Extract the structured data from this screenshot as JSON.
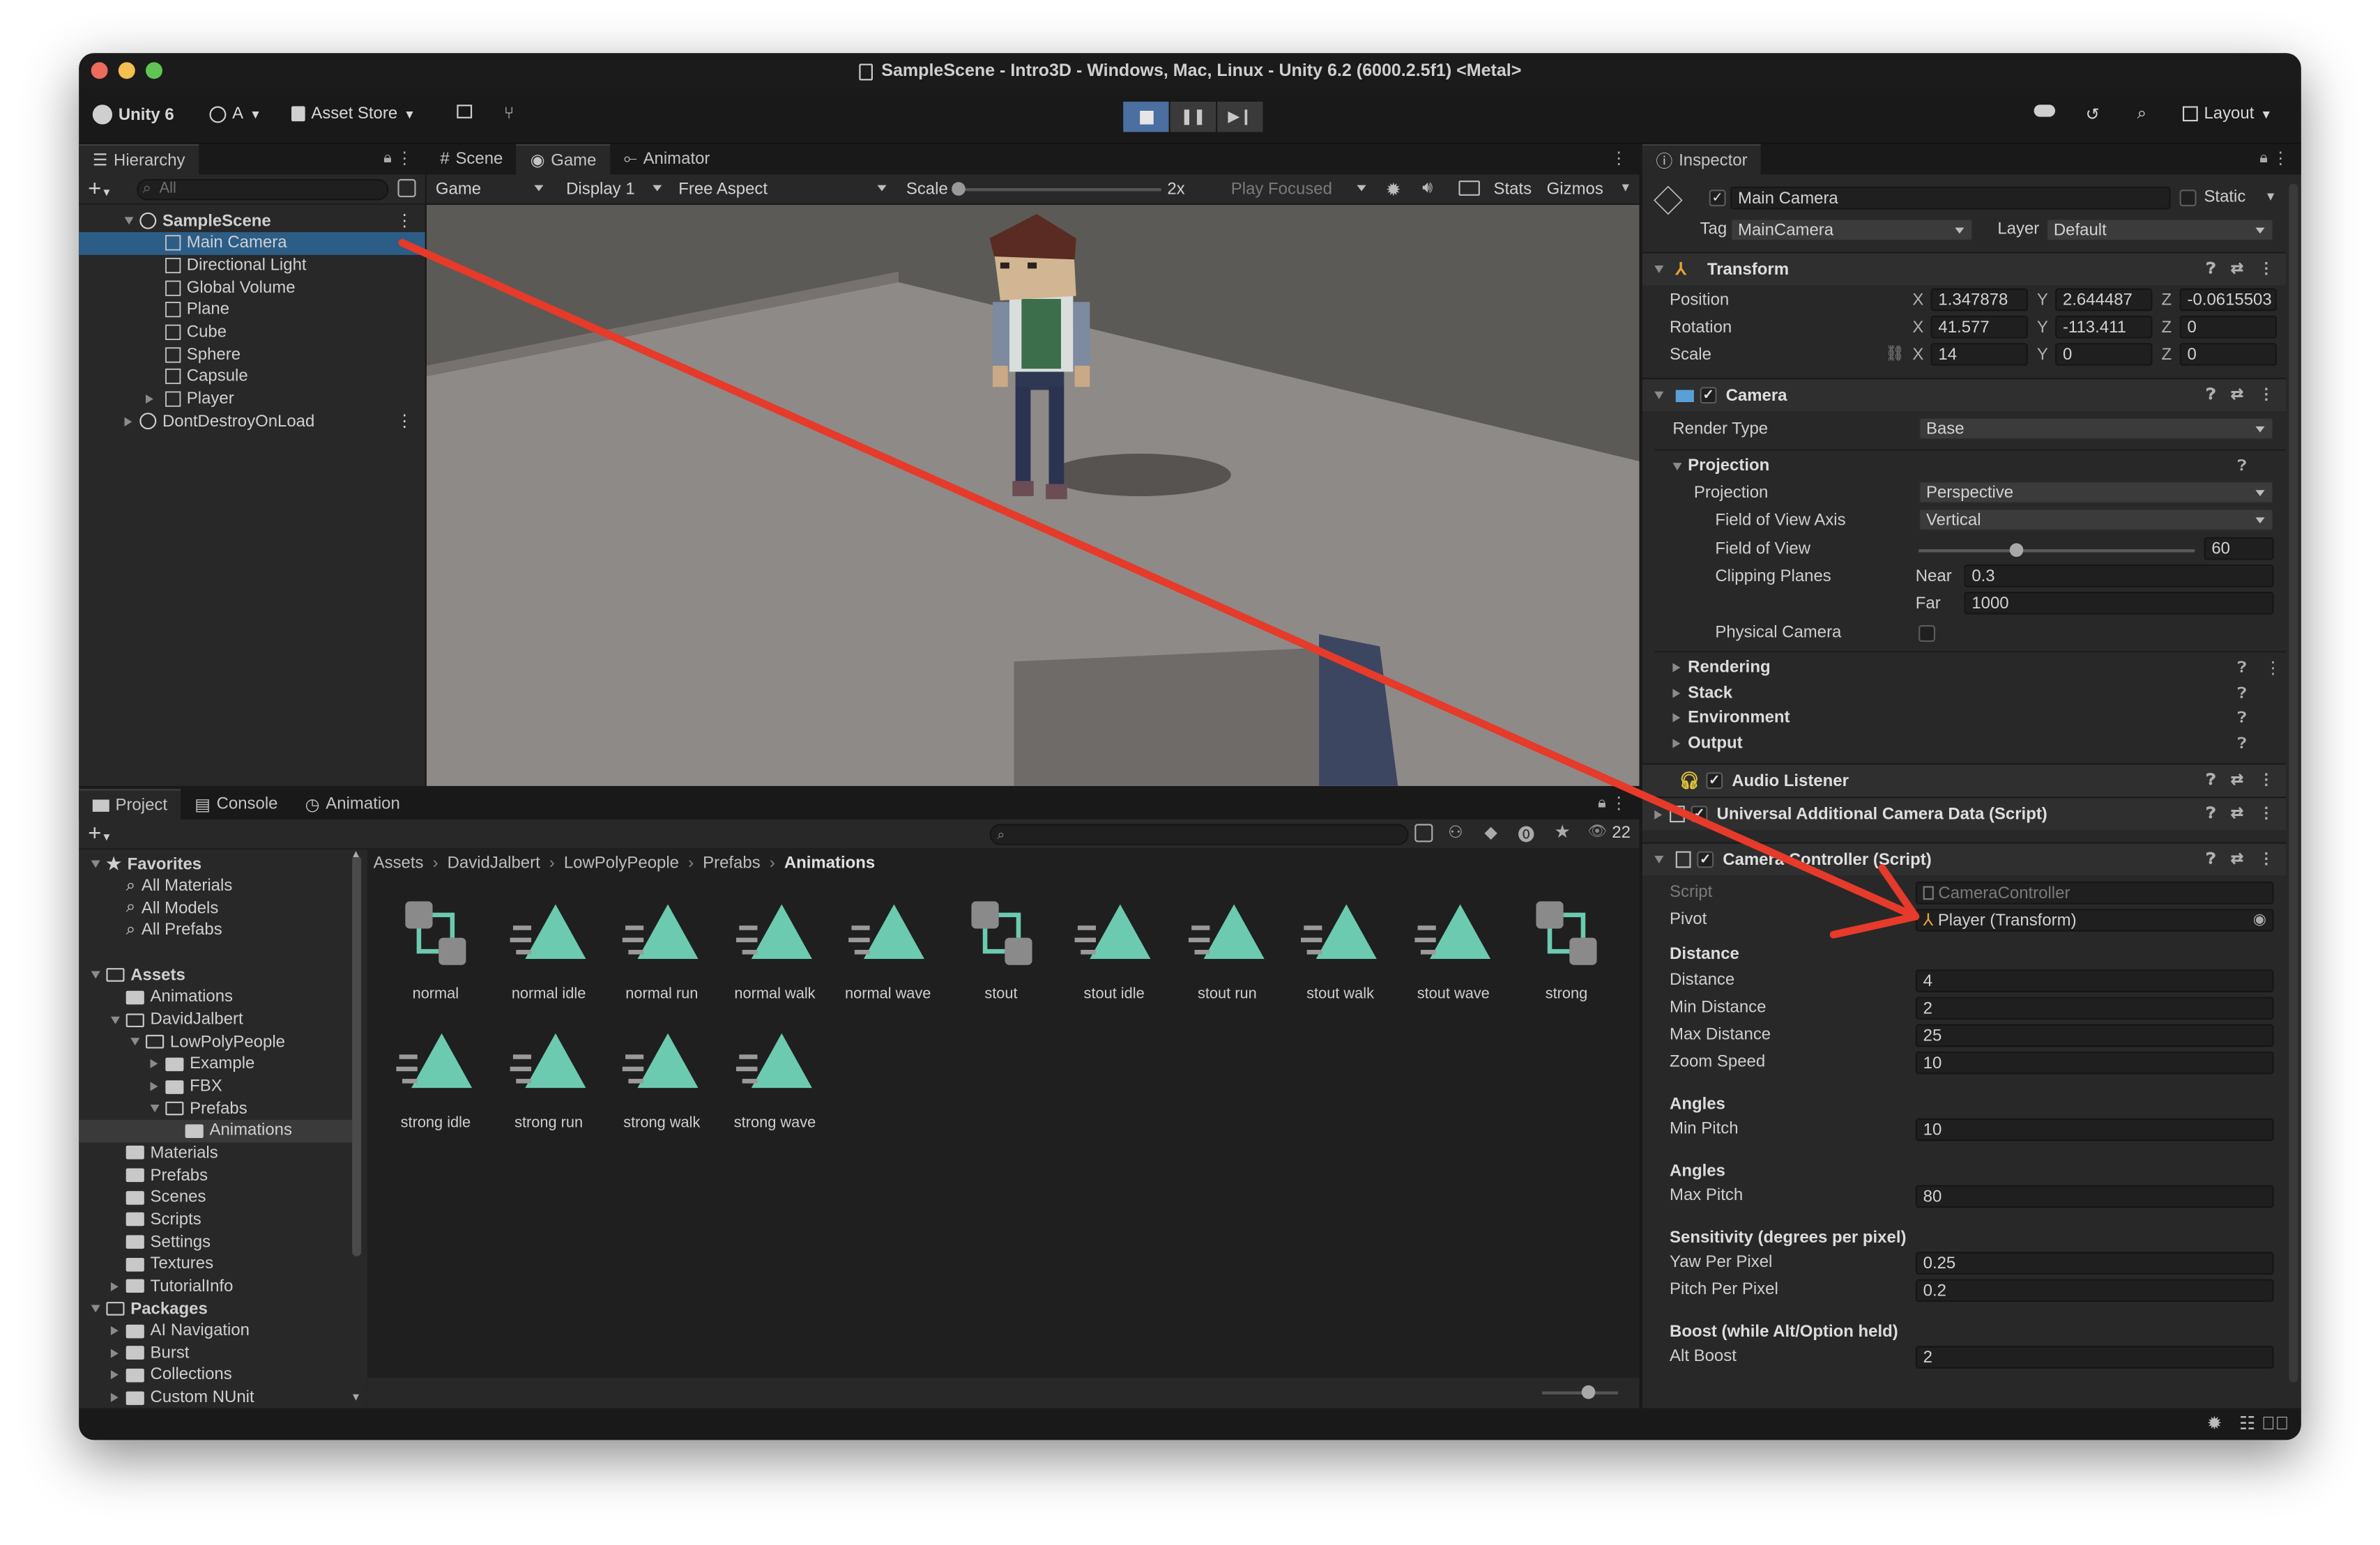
{
  "window": {
    "title": "SampleScene - Intro3D - Windows, Mac, Linux - Unity 6.2 (6000.2.5f1) <Metal>"
  },
  "toolbar": {
    "unity": "Unity 6",
    "account": "A",
    "asset_store": "Asset Store",
    "layout": "Layout"
  },
  "hierarchy": {
    "tab": "Hierarchy",
    "search_placeholder": "All",
    "scene": "SampleScene",
    "items": [
      "Main Camera",
      "Directional Light",
      "Global Volume",
      "Plane",
      "Cube",
      "Sphere",
      "Capsule",
      "Player"
    ],
    "dont_destroy": "DontDestroyOnLoad"
  },
  "view_tabs": [
    "Scene",
    "Game",
    "Animator"
  ],
  "game_bar": {
    "mode": "Game",
    "display": "Display 1",
    "aspect": "Free Aspect",
    "scale_label": "Scale",
    "scale_value": "2x",
    "play_focused": "Play Focused",
    "stats": "Stats",
    "gizmos": "Gizmos"
  },
  "bottom_tabs": [
    "Project",
    "Console",
    "Animation"
  ],
  "project": {
    "asset_count": "22",
    "breadcrumb": [
      "Assets",
      "DavidJalbert",
      "LowPolyPeople",
      "Prefabs",
      "Animations"
    ],
    "favorites": {
      "label": "Favorites",
      "items": [
        "All Materials",
        "All Models",
        "All Prefabs"
      ]
    },
    "assets_label": "Assets",
    "tree": [
      "Animations",
      "DavidJalbert",
      "LowPolyPeople",
      "Example",
      "FBX",
      "Prefabs",
      "Animations",
      "Materials",
      "Prefabs",
      "Scenes",
      "Scripts",
      "Settings",
      "Textures",
      "TutorialInfo"
    ],
    "packages_label": "Packages",
    "packages": [
      "AI Navigation",
      "Burst",
      "Collections",
      "Custom NUnit"
    ],
    "grid": [
      "normal",
      "normal idle",
      "normal run",
      "normal walk",
      "normal wave",
      "stout",
      "stout idle",
      "stout run",
      "stout walk",
      "stout wave",
      "strong",
      "strong idle",
      "strong run",
      "strong walk",
      "strong wave"
    ]
  },
  "inspector": {
    "tab": "Inspector",
    "object": "Main Camera",
    "static": "Static",
    "tag_label": "Tag",
    "tag": "MainCamera",
    "layer_label": "Layer",
    "layer": "Default",
    "transform": {
      "header": "Transform",
      "position_label": "Position",
      "rotation_label": "Rotation",
      "scale_label": "Scale",
      "x": "X",
      "y": "Y",
      "z": "Z",
      "position": [
        "1.347878",
        "2.644487",
        "-0.0615503"
      ],
      "rotation": [
        "41.577",
        "-113.411",
        "0"
      ],
      "scale": [
        "14",
        "0",
        "0"
      ]
    },
    "camera": {
      "header": "Camera",
      "render_type_label": "Render Type",
      "render_type": "Base",
      "projection_section": "Projection",
      "projection_label": "Projection",
      "projection": "Perspective",
      "fov_axis_label": "Field of View Axis",
      "fov_axis": "Vertical",
      "fov_label": "Field of View",
      "fov": "60",
      "fov_fraction": 0.35,
      "clipping_label": "Clipping Planes",
      "near_label": "Near",
      "near": "0.3",
      "far_label": "Far",
      "far": "1000",
      "physical_label": "Physical Camera",
      "sections": [
        "Rendering",
        "Stack",
        "Environment",
        "Output"
      ]
    },
    "audio_listener": "Audio Listener",
    "uacd": "Universal Additional Camera Data (Script)",
    "controller": {
      "header": "Camera Controller (Script)",
      "script_label": "Script",
      "script": "CameraController",
      "pivot_label": "Pivot",
      "pivot": "Player (Transform)",
      "distance_section": "Distance",
      "distance_label": "Distance",
      "distance": "4",
      "min_distance_label": "Min Distance",
      "min_distance": "2",
      "max_distance_label": "Max Distance",
      "max_distance": "25",
      "zoom_speed_label": "Zoom Speed",
      "zoom_speed": "10",
      "angles1": "Angles",
      "min_pitch_label": "Min Pitch",
      "min_pitch": "10",
      "angles2": "Angles",
      "max_pitch_label": "Max Pitch",
      "max_pitch": "80",
      "sensitivity_section": "Sensitivity (degrees per pixel)",
      "yaw_label": "Yaw Per Pixel",
      "yaw": "0.25",
      "pitch_label": "Pitch Per Pixel",
      "pitch": "0.2",
      "boost_section": "Boost (while Alt/Option held)",
      "alt_boost_label": "Alt Boost",
      "alt_boost": "2"
    }
  },
  "colors": {
    "accent": "#2c5d87",
    "annotation_arrow": "#e63a2a",
    "anim_icon": "#6ccab0"
  }
}
